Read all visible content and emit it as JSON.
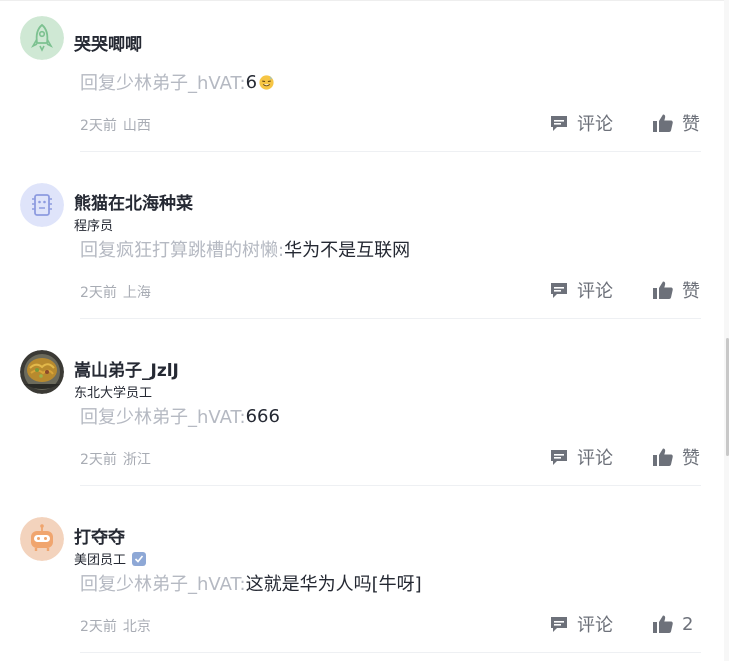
{
  "comments": [
    {
      "username": "哭哭唧唧",
      "title": "",
      "reply_prefix": "回复少林弟子_hVAT:",
      "reply_text": "6",
      "emoji": "sweat-smile-emoji",
      "time": "2天前",
      "location": "山西",
      "comment_label": "评论",
      "like_label": "赞",
      "avatar": "rocket-avatar",
      "avatar_color": "#cfe8d4"
    },
    {
      "username": "熊猫在北海种菜",
      "title": "程序员",
      "reply_prefix": "回复疯狂打算跳槽的树懒:",
      "reply_text": "华为不是互联网",
      "time": "2天前",
      "location": "上海",
      "comment_label": "评论",
      "like_label": "赞",
      "avatar": "robot-chip-avatar",
      "avatar_color": "#dfe4fa"
    },
    {
      "username": "嵩山弟子_JzlJ",
      "title": "东北大学员工",
      "reply_prefix": "回复少林弟子_hVAT:",
      "reply_text": "666",
      "time": "2天前",
      "location": "浙江",
      "comment_label": "评论",
      "like_label": "赞",
      "avatar": "food-photo-avatar"
    },
    {
      "username": "打夺夺",
      "title": "美团员工",
      "verified": true,
      "reply_prefix": "回复少林弟子_hVAT:",
      "reply_text": "这就是华为人吗[牛呀]",
      "time": "2天前",
      "location": "北京",
      "comment_label": "评论",
      "like_label": "2",
      "avatar": "robot-face-avatar",
      "avatar_color": "#f3d3bd"
    }
  ],
  "colors": {
    "username": "#252933",
    "reply_prefix": "#b5b9c2",
    "meta": "#a8acb4",
    "action": "#6d717a"
  }
}
